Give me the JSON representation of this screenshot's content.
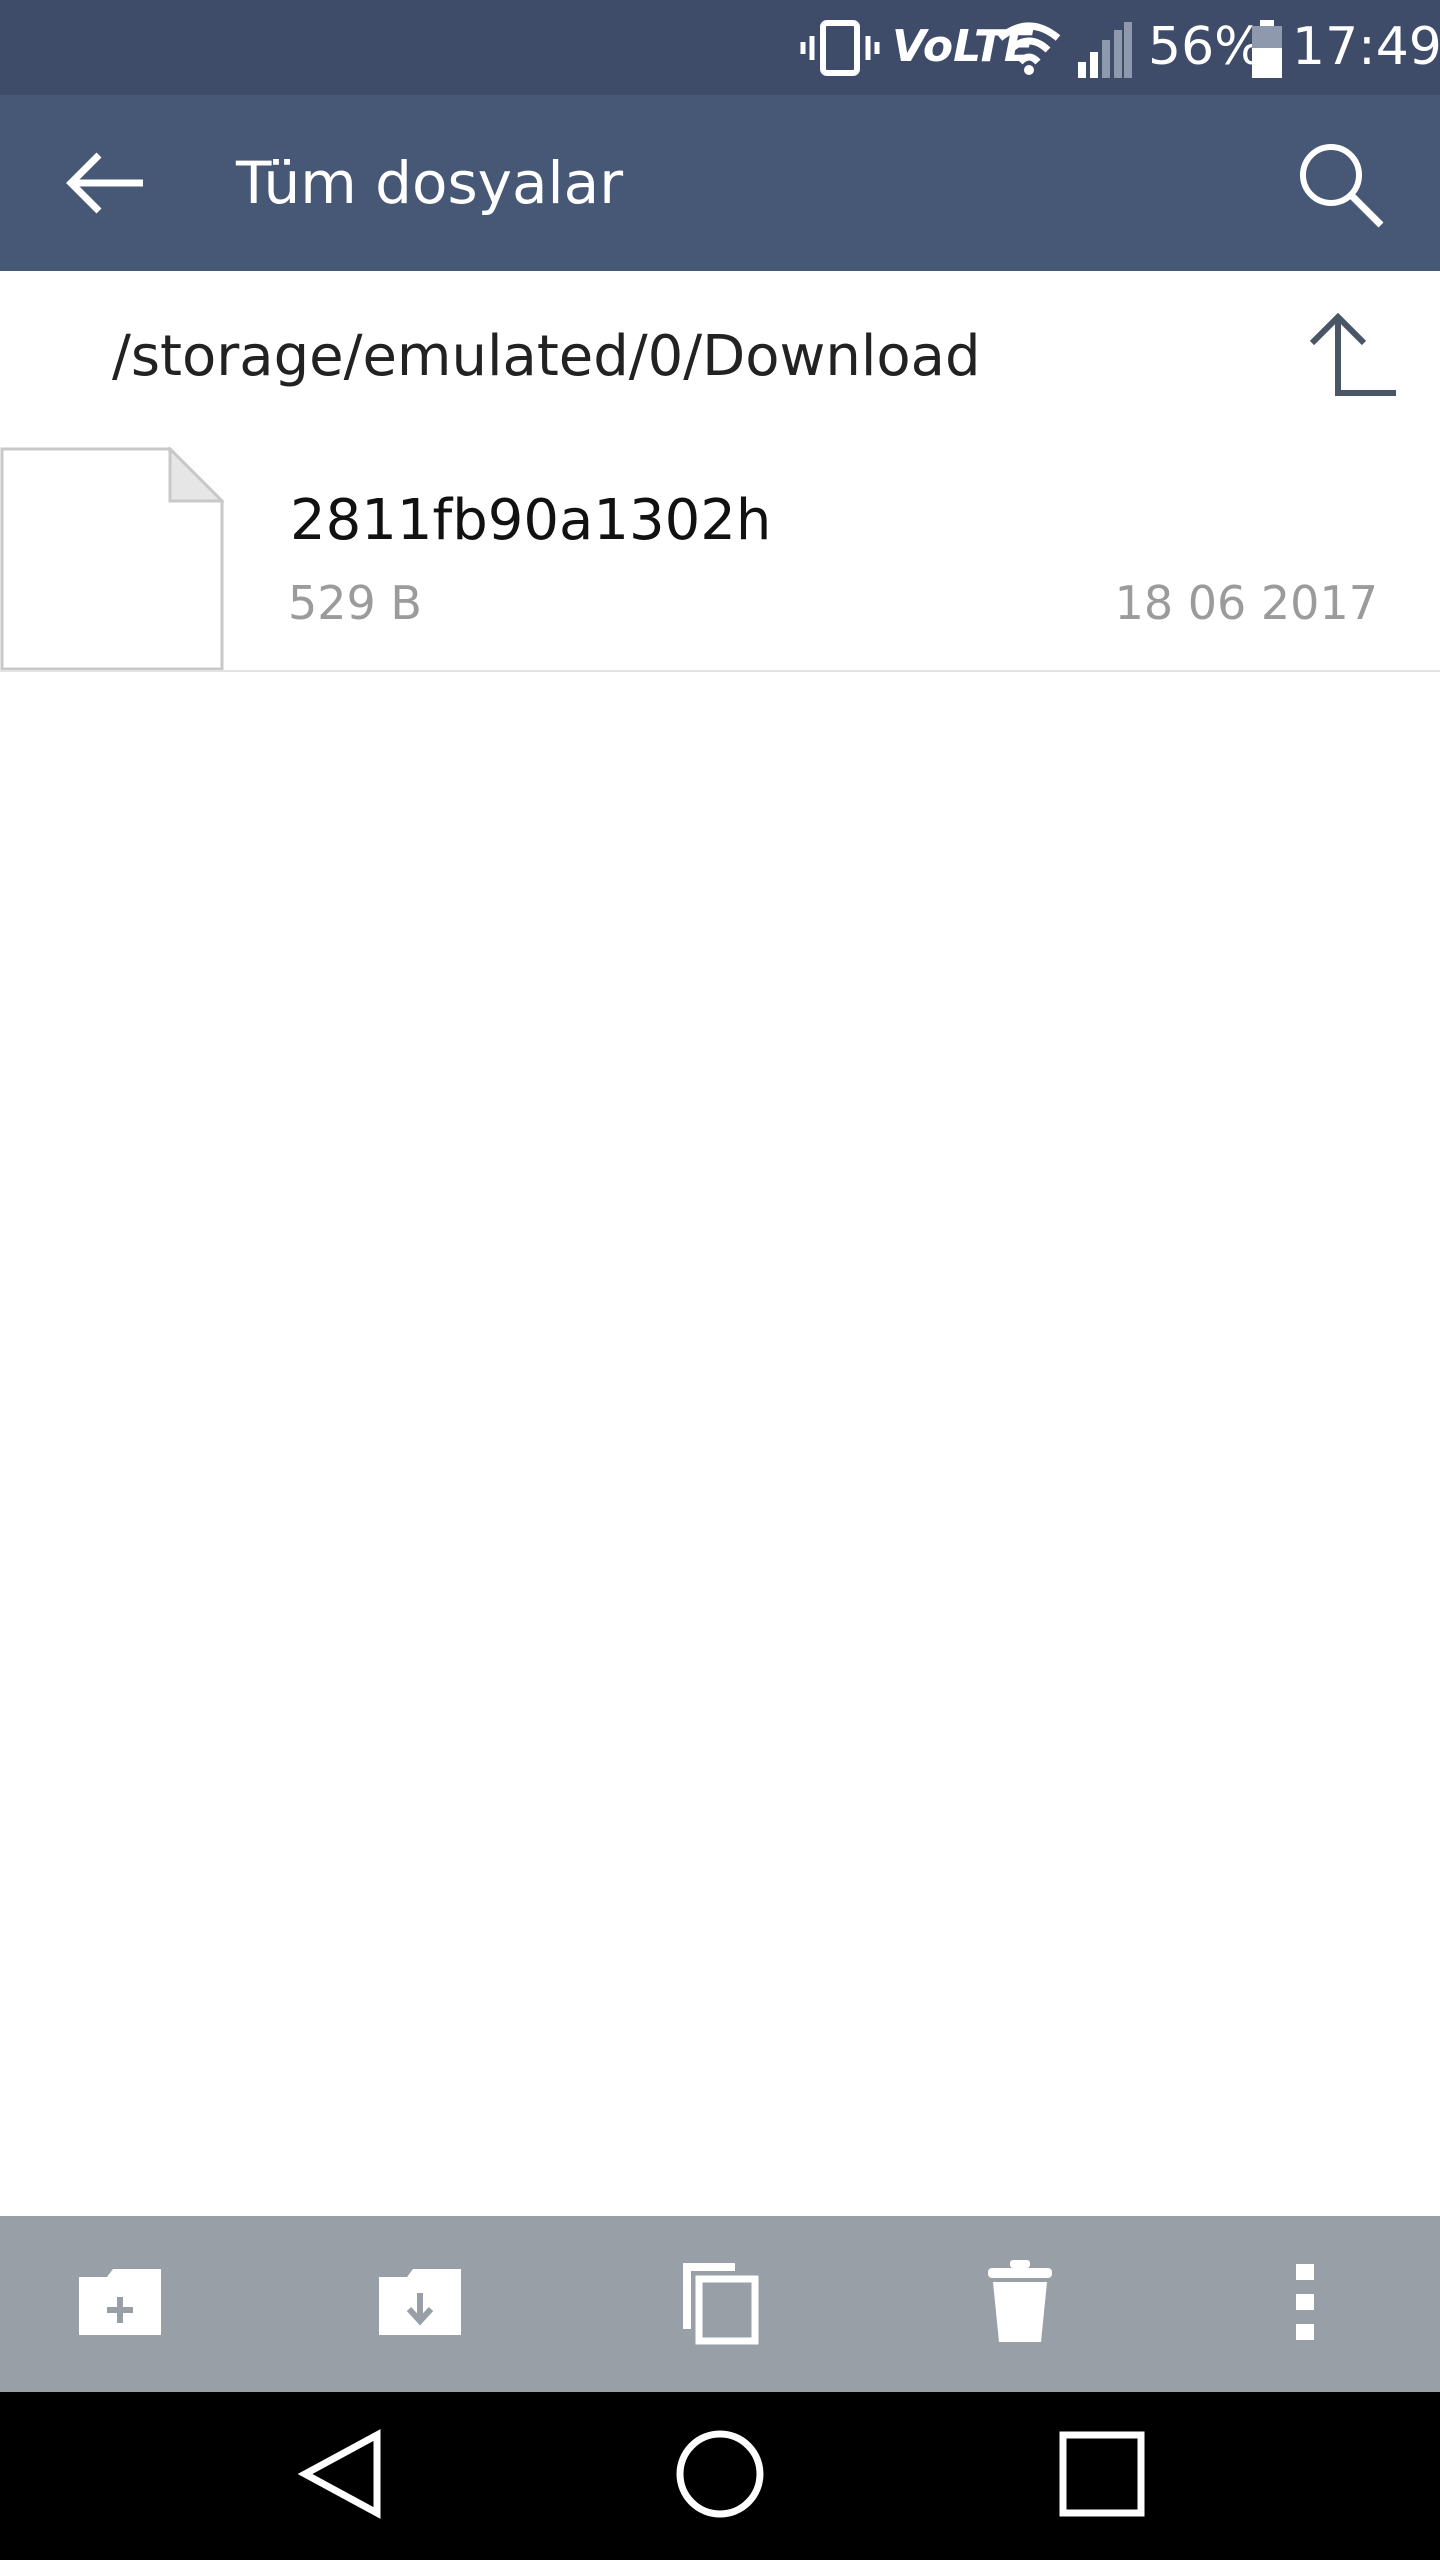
{
  "status_bar": {
    "volte": "VoLTE",
    "battery_percent": "56%",
    "time": "17:49",
    "icons": [
      "vibrate-icon",
      "volte-icon",
      "wifi-icon",
      "signal-icon",
      "battery-icon"
    ]
  },
  "app_bar": {
    "title": "Tüm dosyalar",
    "icons": [
      "back-arrow-icon",
      "search-icon"
    ]
  },
  "path_bar": {
    "path": "/storage/emulated/0/Download",
    "icons": [
      "parent-folder-icon"
    ]
  },
  "files": [
    {
      "name": "2811fb90a1302h",
      "size": "529 B",
      "date": "18 06 2017",
      "icon": "file-icon"
    }
  ],
  "bottom_toolbar": {
    "icons": [
      "new-folder-icon",
      "download-folder-icon",
      "copy-icon",
      "trash-icon",
      "more-vert-icon"
    ]
  },
  "nav_bar": {
    "icons": [
      "nav-back-icon",
      "nav-home-icon",
      "nav-recents-icon"
    ]
  },
  "colors": {
    "status_bar": "#3f4c69",
    "app_bar": "#475776",
    "toolbar": "#989fa7",
    "nav_bar": "#000000"
  }
}
